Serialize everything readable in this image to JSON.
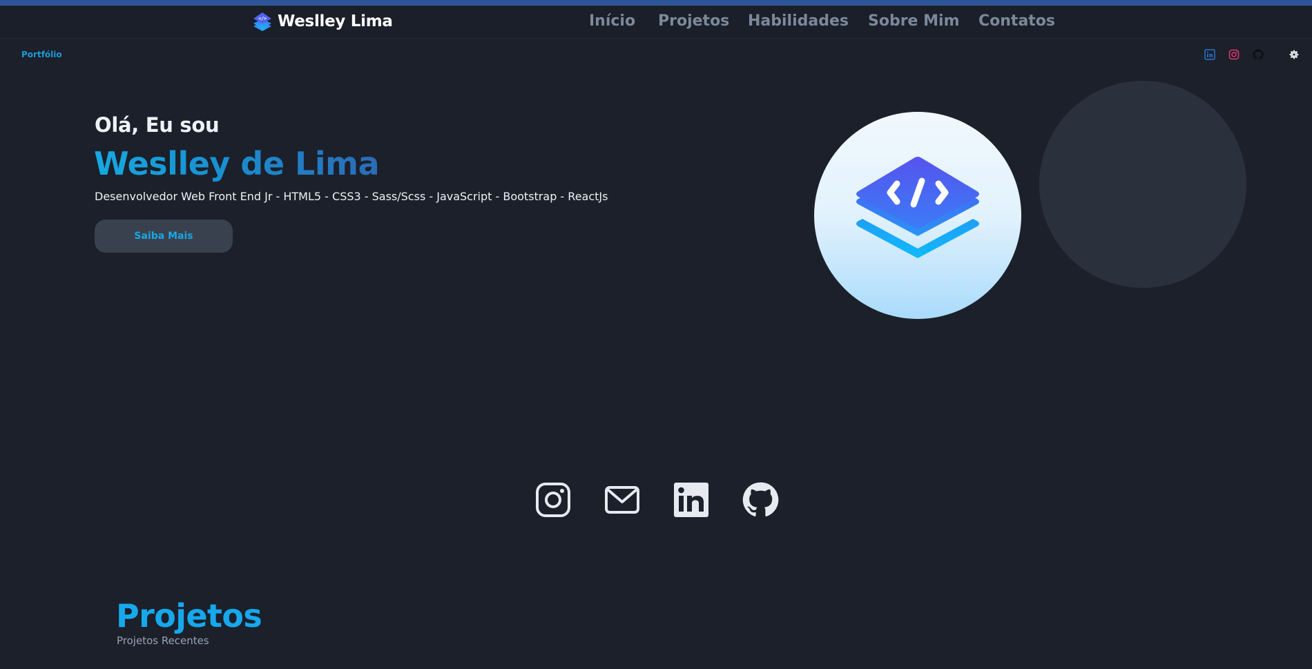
{
  "navbar": {
    "brand": "Weslley Lima",
    "links": [
      "Início",
      "Projetos",
      "Habilidades",
      "Sobre Mim",
      "Contatos"
    ]
  },
  "subheader": {
    "title": "Portfólio",
    "social_icons": [
      "linkedin-icon",
      "instagram-icon",
      "github-icon"
    ],
    "theme_icon": "gear-icon"
  },
  "hero": {
    "greeting": "Olá, Eu sou",
    "name": "Weslley de Lima",
    "role": "Desenvolvedor Web Front End Jr - HTML5 - CSS3 - Sass/Scss - JavaScript - Bootstrap - ReactJs",
    "cta_label": "Saiba Mais"
  },
  "social_links": [
    "instagram-icon",
    "mail-icon",
    "linkedin-icon",
    "github-icon"
  ],
  "projects": {
    "title": "Projetos",
    "subtitle": "Projetos Recentes"
  },
  "colors": {
    "background": "#1b202b",
    "accent": "#17a8ec",
    "nav_text": "#7b899b"
  }
}
